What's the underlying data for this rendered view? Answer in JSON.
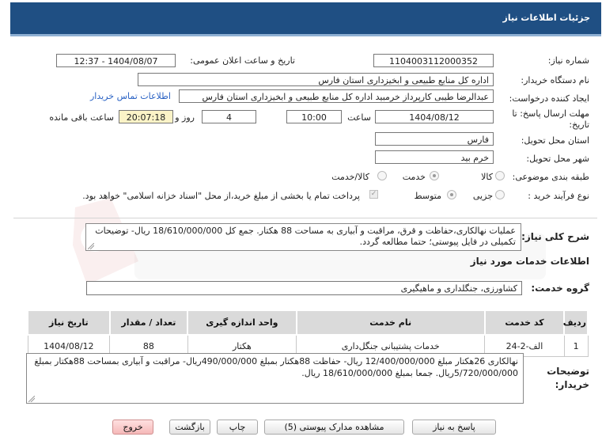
{
  "header": {
    "title": "جزئیات اطلاعات نیاز"
  },
  "form": {
    "need_number_label": "شماره نیاز:",
    "need_number": "1104003112000352",
    "announce_datetime_label": "تاریخ و ساعت اعلان عمومی:",
    "announce_datetime": "1404/08/07 - 12:37",
    "buyer_org_label": "نام دستگاه خریدار:",
    "buyer_org": "اداره کل منابع طبیعی و ابخیزداری استان فارس",
    "requester_label": "ایجاد کننده درخواست:",
    "requester": "عبدالرضا طیبی کارپرداز خرمبید اداره کل منابع طبیعی و ابخیزداری استان فارس",
    "buyer_contact_link": "اطلاعات تماس خریدار",
    "deadline_label_line1": "مهلت ارسال پاسخ: تا",
    "deadline_label_line2": "تاریخ:",
    "deadline_date": "1404/08/12",
    "time_label": "ساعت",
    "deadline_time": "10:00",
    "days": "4",
    "days_label": "روز و",
    "remaining_time": "20:07:18",
    "remaining_label": "ساعت باقی مانده",
    "province_label": "استان محل تحویل:",
    "province": "فارس",
    "city_label": "شهر محل تحویل:",
    "city": "خرم بید",
    "category_label": "طبقه بندی موضوعی:",
    "category_options": [
      "کالا",
      "خدمت",
      "کالا/خدمت"
    ],
    "category_selected": "خدمت",
    "process_label": "نوع فرآیند خرید :",
    "process_options": [
      "جزیی",
      "متوسط"
    ],
    "process_selected": "متوسط",
    "payment_note": "پرداخت تمام یا بخشی از مبلغ خرید،از محل \"اسناد خزانه اسلامی\" خواهد بود."
  },
  "summary": {
    "label": "شرح کلی نیاز:",
    "text": "عملیات نهالکاری،حفاظت و قرق، مراقبت و آبیاری به مساحت 88 هکتار. جمع کل 18/610/000/000 ریال- توضیحات تکمیلی در فایل پیوستی؛ حتما مطالعه گردد."
  },
  "services": {
    "section_title": "اطلاعات خدمات مورد نیاز",
    "group_label": "گروه خدمت:",
    "group_value": "کشاورزی، جنگلداری و ماهیگیری",
    "columns": [
      "ردیف",
      "کد خدمت",
      "نام خدمت",
      "واحد اندازه گیری",
      "تعداد / مقدار",
      "تاریخ نیاز"
    ],
    "rows": [
      {
        "row": "1",
        "code": "الف-2-24",
        "name": "خدمات پشتیبانی جنگل‌داری",
        "unit": "هکتار",
        "qty": "88",
        "date": "1404/08/12"
      }
    ]
  },
  "buyer_notes": {
    "label_line1": "توضیحات",
    "label_line2": "خریدار:",
    "text": "نهالکاری 26هکتار مبلغ 12/400/000/000 ریال- حفاظت 88هکتار بمبلغ 490/000/000ریال- مراقبت و آبیاری بمساحت 88هکتار بمبلغ 5/720/000/000ریال. جمعا بمبلغ 18/610/000/000 ریال."
  },
  "buttons": {
    "reply": "پاسخ به نیاز",
    "attachments": "مشاهده مدارک پیوستی (5)",
    "print": "چاپ",
    "back": "بازگشت",
    "exit": "خروج"
  },
  "colors": {
    "header_bg": "#1f4f83",
    "link": "#2a62c4",
    "remaining_bg": "#fbf3c7",
    "exit_bg": "#f5b8b8"
  }
}
